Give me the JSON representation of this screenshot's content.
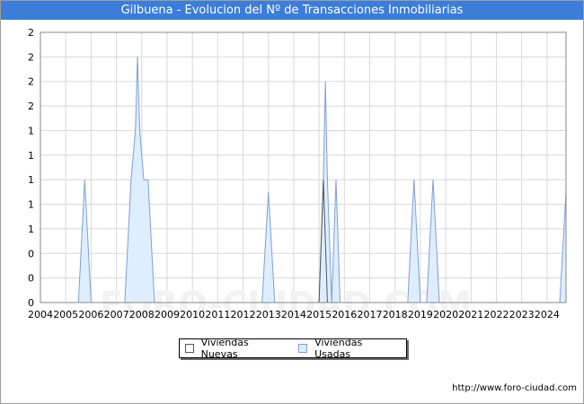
{
  "title": "Gilbuena - Evolucion del Nº de Transacciones Inmobiliarias",
  "source": "http://www.foro-ciudad.com",
  "watermark": "FORO-CIUDAD.COM",
  "colors": {
    "title_bg": "#3b7dd8",
    "nuevas_fill": "#ffffff",
    "nuevas_stroke": "#555555",
    "usadas_fill": "#ddeeff",
    "usadas_stroke": "#7f9fd6",
    "grid": "#d8d8d8"
  },
  "chart_data": {
    "type": "area",
    "title": "Gilbuena - Evolucion del Nº de Transacciones Inmobiliarias",
    "xlabel": "",
    "ylabel": "",
    "xlim": [
      2004,
      2024.75
    ],
    "ylim": [
      0,
      2.2
    ],
    "grid": true,
    "legend_position": "bottom",
    "x_ticks": [
      "2004",
      "2005",
      "2006",
      "2007",
      "2008",
      "2009",
      "2010",
      "2011",
      "2012",
      "2013",
      "2014",
      "2015",
      "2016",
      "2017",
      "2018",
      "2019",
      "2020",
      "2021",
      "2022",
      "2023",
      "2024"
    ],
    "y_ticks": [
      {
        "value": 0,
        "label": "0"
      },
      {
        "value": 0.2,
        "label": "0"
      },
      {
        "value": 0.4,
        "label": "0"
      },
      {
        "value": 0.6,
        "label": "1"
      },
      {
        "value": 0.8,
        "label": "1"
      },
      {
        "value": 1.0,
        "label": "1"
      },
      {
        "value": 1.2,
        "label": "1"
      },
      {
        "value": 1.4,
        "label": "1"
      },
      {
        "value": 1.6,
        "label": "2"
      },
      {
        "value": 1.8,
        "label": "2"
      },
      {
        "value": 2.0,
        "label": "2"
      },
      {
        "value": 2.2,
        "label": "2"
      }
    ],
    "series": [
      {
        "name": "Viviendas Usadas",
        "points": [
          [
            2005.5,
            0
          ],
          [
            2005.75,
            1
          ],
          [
            2006.0,
            0
          ],
          [
            2007.33,
            0
          ],
          [
            2007.58,
            1
          ],
          [
            2007.75,
            1.4
          ],
          [
            2007.83,
            2
          ],
          [
            2007.92,
            1.4
          ],
          [
            2008.08,
            1
          ],
          [
            2008.25,
            1
          ],
          [
            2008.5,
            0
          ],
          [
            2012.75,
            0
          ],
          [
            2013.0,
            0.9
          ],
          [
            2013.25,
            0
          ],
          [
            2015.0,
            0
          ],
          [
            2015.17,
            1
          ],
          [
            2015.25,
            1.8
          ],
          [
            2015.33,
            1
          ],
          [
            2015.5,
            0
          ],
          [
            2015.67,
            1
          ],
          [
            2015.83,
            0
          ],
          [
            2018.5,
            0
          ],
          [
            2018.75,
            1
          ],
          [
            2019.0,
            0
          ],
          [
            2019.25,
            0
          ],
          [
            2019.5,
            1
          ],
          [
            2019.75,
            0
          ],
          [
            2024.5,
            0
          ],
          [
            2024.75,
            0.9
          ]
        ]
      },
      {
        "name": "Viviendas Nuevas",
        "points": [
          [
            2015.0,
            0
          ],
          [
            2015.17,
            1
          ],
          [
            2015.33,
            0
          ]
        ]
      }
    ]
  }
}
